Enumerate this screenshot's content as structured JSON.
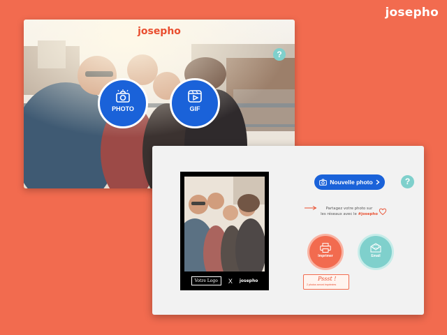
{
  "brand": {
    "name": "josepho",
    "accent": "#e94e2f",
    "background": "#f26b4f"
  },
  "screen_home": {
    "logo": "josepho",
    "buttons": [
      {
        "label": "PHOTO",
        "icon": "camera-icon"
      },
      {
        "label": "GIF",
        "icon": "gif-play-icon"
      }
    ],
    "help": "?"
  },
  "screen_result": {
    "frame": {
      "logo_placeholder": "Votre Logo",
      "separator": "X",
      "brand": "josepho"
    },
    "new_photo_label": "Nouvelle photo",
    "help": "?",
    "share": {
      "line1": "Partagez votre photo sur",
      "line2": "les réseaux avec le",
      "hashtag": "#josepho"
    },
    "actions": [
      {
        "label": "Imprimer",
        "icon": "printer-icon",
        "color": "#f26b4f"
      },
      {
        "label": "Email",
        "icon": "envelope-icon",
        "color": "#7fd0cc"
      }
    ],
    "badge": {
      "title": "Pssst !",
      "note": "2 photos seront imprimées"
    }
  }
}
